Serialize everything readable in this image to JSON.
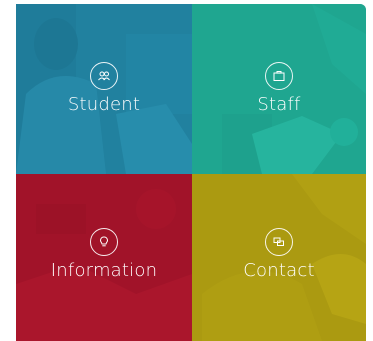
{
  "tiles": [
    {
      "label": "Student",
      "icon": "users-icon",
      "overlay": "#1f8fb0"
    },
    {
      "label": "Staff",
      "icon": "briefcase-icon",
      "overlay": "#1fb099"
    },
    {
      "label": "Information",
      "icon": "lightbulb-icon",
      "overlay": "#b0152c"
    },
    {
      "label": "Contact",
      "icon": "chat-icon",
      "overlay": "#b5a312"
    }
  ]
}
